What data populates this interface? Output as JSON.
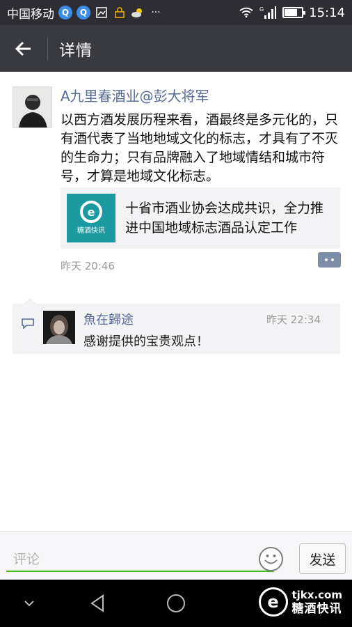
{
  "status_bar": {
    "carrier": "中国移动",
    "time": "15:14",
    "network_badge": "G",
    "battery_level": 0.75
  },
  "header": {
    "back_icon": "arrow-left-icon",
    "title": "详情"
  },
  "post": {
    "author": "A九里春酒业@彭大将军",
    "text": "以西方酒发展历程来看，酒最终是多元化的，只有酒代表了当地地域文化的标志，才具有了不灭的生命力；只有品牌融入了地域情结和城市符号，才算是地域文化标志。",
    "link_card": {
      "title": "十省市酒业协会达成共识，全力推进中国地域标志酒品认定工作",
      "thumb_caption": "糖酒快讯",
      "thumb_color": "#1a9aa0"
    },
    "time": "昨天 20:46"
  },
  "comments": [
    {
      "author": "魚在歸途",
      "time": "昨天 22:34",
      "text": "感谢提供的宝贵观点！"
    }
  ],
  "input_bar": {
    "placeholder": "评论",
    "send_label": "发送"
  },
  "watermark": {
    "domain": "tjkx.com",
    "name": "糖酒快讯"
  },
  "colors": {
    "status_bar_bg": "#2d2d33",
    "title_bar_bg": "#393a3f",
    "link_blue": "#576b95",
    "accent_green": "#45c01a"
  }
}
